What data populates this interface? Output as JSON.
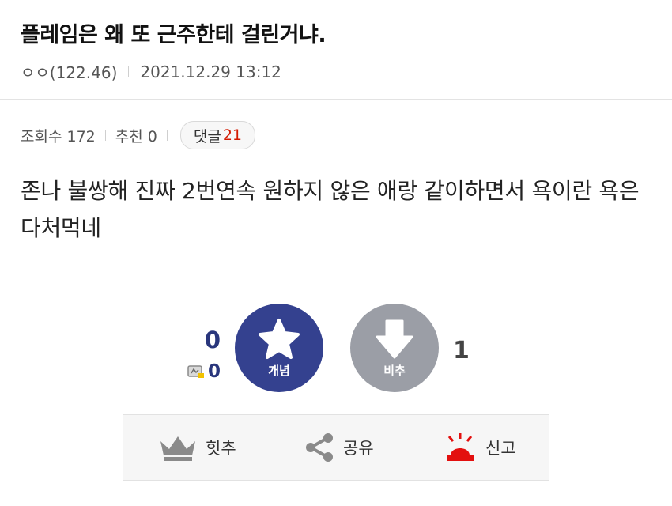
{
  "post": {
    "title": "플레임은 왜 또 근주한테 걸린거냐.",
    "author": "ㅇㅇ(122.46)",
    "datetime": "2021.12.29 13:12",
    "views_label": "조회수 172",
    "recommend_label": "추천 0",
    "comment_label": "댓글",
    "comment_count": "21",
    "body": "존나 불쌍해 진짜 2번연속 원하지 않은 애랑 같이하면서 욕이란 욕은 다처먹네"
  },
  "votes": {
    "up_count": "0",
    "fixed_up_count": "0",
    "up_label": "개념",
    "down_label": "비추",
    "down_count": "1",
    "up_color": "#34418f",
    "down_color": "#9b9ea6"
  },
  "actions": {
    "hit": {
      "label": "힛추",
      "icon": "crown-icon"
    },
    "share": {
      "label": "공유",
      "icon": "share-icon"
    },
    "report": {
      "label": "신고",
      "icon": "siren-icon",
      "color": "#e3100f"
    }
  }
}
